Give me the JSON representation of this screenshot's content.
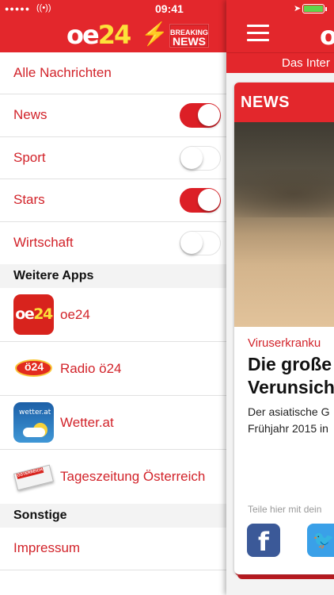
{
  "status": {
    "time": "09:41",
    "signal": "●●●●●",
    "wifi": "((•))"
  },
  "header": {
    "logo_text_oe": "oe",
    "logo_text_num": "24",
    "bolt": "⚡",
    "badge_line1": "BREAKING",
    "badge_line2": "NEWS"
  },
  "menu": {
    "all_news": "Alle Nachrichten",
    "toggles": [
      {
        "label": "News",
        "on": true
      },
      {
        "label": "Sport",
        "on": false
      },
      {
        "label": "Stars",
        "on": true
      },
      {
        "label": "Wirtschaft",
        "on": false
      }
    ],
    "section_apps": "Weitere Apps",
    "apps": [
      {
        "label": "oe24",
        "icon": "oe24-app-icon"
      },
      {
        "label": "Radio ö24",
        "icon": "radio-app-icon"
      },
      {
        "label": "Wetter.at",
        "icon": "wetter-app-icon"
      },
      {
        "label": "Tageszeitung Österreich",
        "icon": "newspaper-app-icon"
      }
    ],
    "icon_texts": {
      "oe24_a": "oe",
      "oe24_b": "24",
      "radio": "ö24",
      "wetter": "wetter.at",
      "paper": "ÖSTERREICH"
    },
    "section_other": "Sonstige",
    "impressum": "Impressum"
  },
  "content": {
    "logo_partial": "o",
    "subtitle": "Das Inter",
    "card": {
      "category": "NEWS",
      "kicker": "Viruserkranku",
      "headline_line1": "Die große",
      "headline_line2": "Verunsich",
      "teaser_line1": "Der asiatische G",
      "teaser_line2": "Frühjahr 2015 in",
      "share_label": "Teile hier mit dein",
      "facebook": "f",
      "twitter": "🐦"
    }
  },
  "colors": {
    "brand_red": "#e3272c",
    "text_red": "#d2232a",
    "toggle_on": "#dc1f26",
    "logo_yellow": "#fde13a"
  }
}
